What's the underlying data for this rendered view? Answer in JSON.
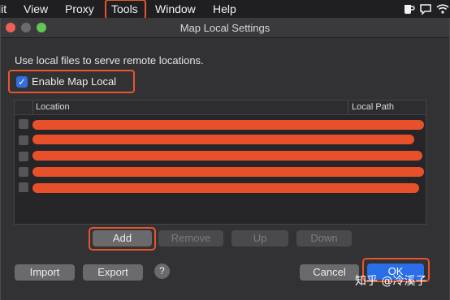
{
  "menubar": {
    "items": [
      "lit",
      "View",
      "Proxy",
      "Tools",
      "Window",
      "Help"
    ],
    "icons": [
      "mug-icon",
      "comment-icon",
      "wifi-icon"
    ]
  },
  "window": {
    "title": "Map Local Settings",
    "description": "Use local files to serve remote locations.",
    "enable_label": "Enable Map Local",
    "enable_checked": true
  },
  "table": {
    "headers": {
      "location": "Location",
      "local_path": "Local Path"
    },
    "rows": [
      {
        "enabled": false,
        "location": "",
        "local_path": ""
      },
      {
        "enabled": false,
        "location": "",
        "local_path": ""
      },
      {
        "enabled": false,
        "location": "",
        "local_path": ""
      },
      {
        "enabled": false,
        "location": "",
        "local_path": ""
      },
      {
        "enabled": false,
        "location": "",
        "local_path": ""
      }
    ]
  },
  "buttons": {
    "add": "Add",
    "remove": "Remove",
    "up": "Up",
    "down": "Down",
    "import": "Import",
    "export": "Export",
    "help": "?",
    "cancel": "Cancel",
    "ok": "OK"
  },
  "watermark": "知乎 @冷溪子",
  "colors": {
    "highlight": "#e8552c",
    "redaction": "#e8502b",
    "accent": "#2a6ee8",
    "checkbox": "#2f6fe0"
  }
}
